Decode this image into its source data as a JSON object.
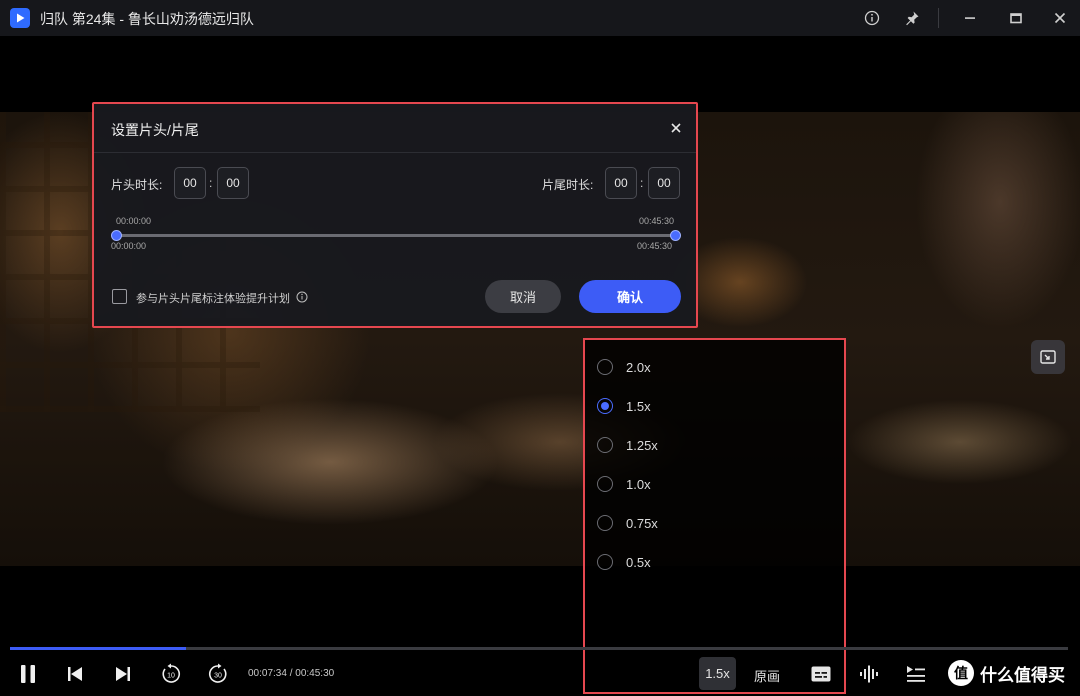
{
  "window": {
    "title": "归队 第24集 - 鲁长山劝汤德远归队"
  },
  "dialog": {
    "title": "设置片头/片尾",
    "intro_label": "片头时长:",
    "intro_min": "00",
    "intro_sec": "00",
    "outro_label": "片尾时长:",
    "outro_min": "00",
    "outro_sec": "00",
    "colon": ":",
    "range_start_top": "00:00:00",
    "range_end_top": "00:45:30",
    "range_start_bottom": "00:00:00",
    "range_end_bottom": "00:45:30",
    "checkbox_label": "参与片头片尾标注体验提升计划",
    "cancel_label": "取消",
    "confirm_label": "确认"
  },
  "speed_menu": {
    "options": [
      "2.0x",
      "1.5x",
      "1.25x",
      "1.0x",
      "0.75x",
      "0.5x"
    ],
    "selected": "1.5x"
  },
  "player": {
    "current_time": "00:07:34",
    "total_time": "00:45:30",
    "time_separator": " / ",
    "time_display": "00:07:34 / 00:45:30",
    "progress_fraction": 0.166,
    "rewind_seconds": "10",
    "forward_seconds": "30",
    "speed_label": "1.5x",
    "quality_label": "原画"
  },
  "watermark": {
    "badge": "值",
    "text": "什么值得买"
  },
  "colors": {
    "accent": "#3d5cf6",
    "highlight_border": "#e5474f",
    "titlebar_bg": "#16171b"
  }
}
